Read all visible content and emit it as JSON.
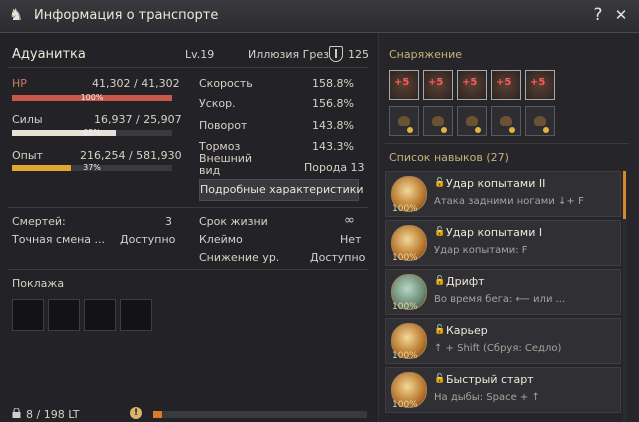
{
  "window": {
    "title": "Информация о транспорте",
    "help": "?",
    "close": "✕"
  },
  "mount": {
    "name": "Адуанитка",
    "level": "Lv.19",
    "illusion_label": "Иллюзия Грез",
    "illusion_value": "125"
  },
  "stats": {
    "hp": {
      "label": "HP",
      "value": "41,302 / 41,302",
      "pct": "100%",
      "fraction": 1.0,
      "color": "#c9574a"
    },
    "stamina": {
      "label": "Силы",
      "value": "16,937 / 25,907",
      "pct": "65%",
      "fraction": 0.65,
      "color": "#e6e2d8"
    },
    "exp": {
      "label": "Опыт",
      "value": "216,254 / 581,930",
      "pct": "37%",
      "fraction": 0.37,
      "color": "#e0a830"
    }
  },
  "attributes": [
    {
      "label": "Скорость",
      "value": "158.8%"
    },
    {
      "label": "Ускор.",
      "value": "156.8%"
    },
    {
      "label": "Поворот",
      "value": "143.8%"
    },
    {
      "label": "Тормоз",
      "value": "143.3%"
    }
  ],
  "appearance": {
    "label": "Внешний вид",
    "value": "Порода 13"
  },
  "detail_button": "Подробные характеристики",
  "info_left": [
    {
      "label": "Смертей:",
      "value": "3"
    },
    {
      "label": "Точная смена ...",
      "value": "Доступно"
    }
  ],
  "info_right": [
    {
      "label": "Срок жизни",
      "value": "∞"
    },
    {
      "label": "Клеймо",
      "value": "Нет"
    },
    {
      "label": "Снижение ур.",
      "value": "Доступно"
    }
  ],
  "cargo": {
    "title": "Поклажа",
    "weight": "8 / 198 LT",
    "weight_fraction": 0.04,
    "warn": "!"
  },
  "equipment": {
    "title": "Снаряжение",
    "row1": [
      "+5",
      "+5",
      "+5",
      "+5",
      "+5"
    ],
    "row2_count": 5
  },
  "skills": {
    "title": "Список навыков (27)",
    "items": [
      {
        "name": "Удар копытами II",
        "desc": "Атака задними ногами ↓+ F",
        "pct": "100%"
      },
      {
        "name": "Удар копытами I",
        "desc": "Удар копытами: F",
        "pct": "100%"
      },
      {
        "name": "Дрифт",
        "desc": "Во время бега:  ⟵  или ...",
        "pct": "100%"
      },
      {
        "name": "Карьер",
        "desc": "↑  + Shift (Сбруя: Седло)",
        "pct": "100%"
      },
      {
        "name": "Быстрый старт",
        "desc": "На дыбы: Space +  ↑",
        "pct": "100%"
      }
    ]
  }
}
